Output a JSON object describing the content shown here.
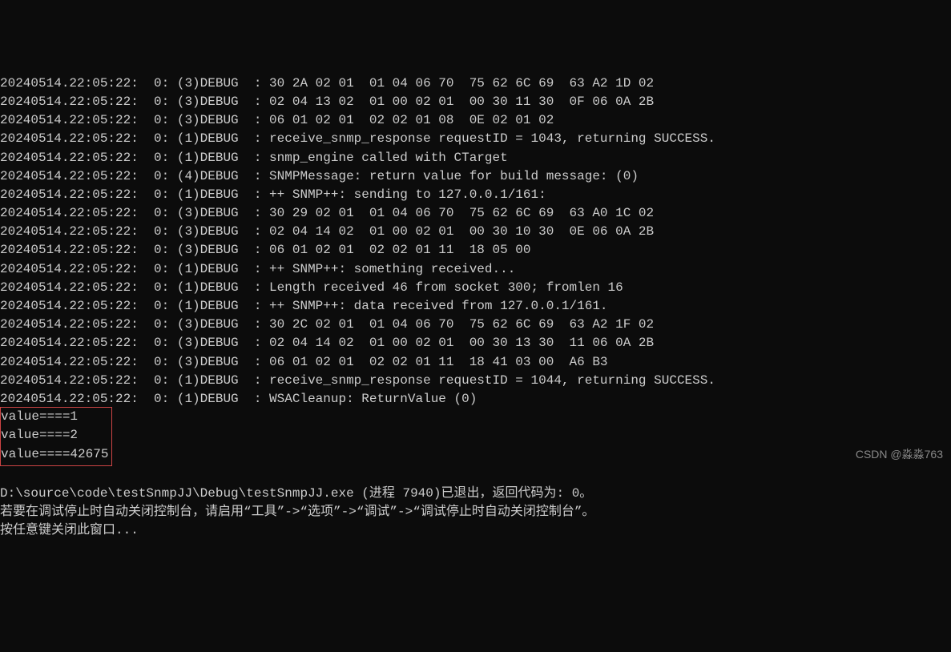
{
  "log_lines": [
    "20240514.22:05:22:  0: (3)DEBUG  : 30 2A 02 01  01 04 06 70  75 62 6C 69  63 A2 1D 02",
    "20240514.22:05:22:  0: (3)DEBUG  : 02 04 13 02  01 00 02 01  00 30 11 30  0F 06 0A 2B",
    "20240514.22:05:22:  0: (3)DEBUG  : 06 01 02 01  02 02 01 08  0E 02 01 02",
    "20240514.22:05:22:  0: (1)DEBUG  : receive_snmp_response requestID = 1043, returning SUCCESS.",
    "20240514.22:05:22:  0: (1)DEBUG  : snmp_engine called with CTarget",
    "20240514.22:05:22:  0: (4)DEBUG  : SNMPMessage: return value for build message: (0)",
    "20240514.22:05:22:  0: (1)DEBUG  : ++ SNMP++: sending to 127.0.0.1/161:",
    "20240514.22:05:22:  0: (3)DEBUG  : 30 29 02 01  01 04 06 70  75 62 6C 69  63 A0 1C 02",
    "20240514.22:05:22:  0: (3)DEBUG  : 02 04 14 02  01 00 02 01  00 30 10 30  0E 06 0A 2B",
    "20240514.22:05:22:  0: (3)DEBUG  : 06 01 02 01  02 02 01 11  18 05 00",
    "20240514.22:05:22:  0: (1)DEBUG  : ++ SNMP++: something received...",
    "20240514.22:05:22:  0: (1)DEBUG  : Length received 46 from socket 300; fromlen 16",
    "20240514.22:05:22:  0: (1)DEBUG  : ++ SNMP++: data received from 127.0.0.1/161.",
    "20240514.22:05:22:  0: (3)DEBUG  : 30 2C 02 01  01 04 06 70  75 62 6C 69  63 A2 1F 02",
    "20240514.22:05:22:  0: (3)DEBUG  : 02 04 14 02  01 00 02 01  00 30 13 30  11 06 0A 2B",
    "20240514.22:05:22:  0: (3)DEBUG  : 06 01 02 01  02 02 01 11  18 41 03 00  A6 B3",
    "20240514.22:05:22:  0: (1)DEBUG  : receive_snmp_response requestID = 1044, returning SUCCESS.",
    "20240514.22:05:22:  0: (1)DEBUG  : WSACleanup: ReturnValue (0)"
  ],
  "highlighted_values": [
    "value====1",
    "value====2",
    "value====42675"
  ],
  "footer_lines": [
    "",
    "D:\\source\\code\\testSnmpJJ\\Debug\\testSnmpJJ.exe (进程 7940)已退出，返回代码为: 0。",
    "若要在调试停止时自动关闭控制台，请启用“工具”->“选项”->“调试”->“调试停止时自动关闭控制台”。",
    "按任意键关闭此窗口..."
  ],
  "watermark": "CSDN @淼淼763"
}
